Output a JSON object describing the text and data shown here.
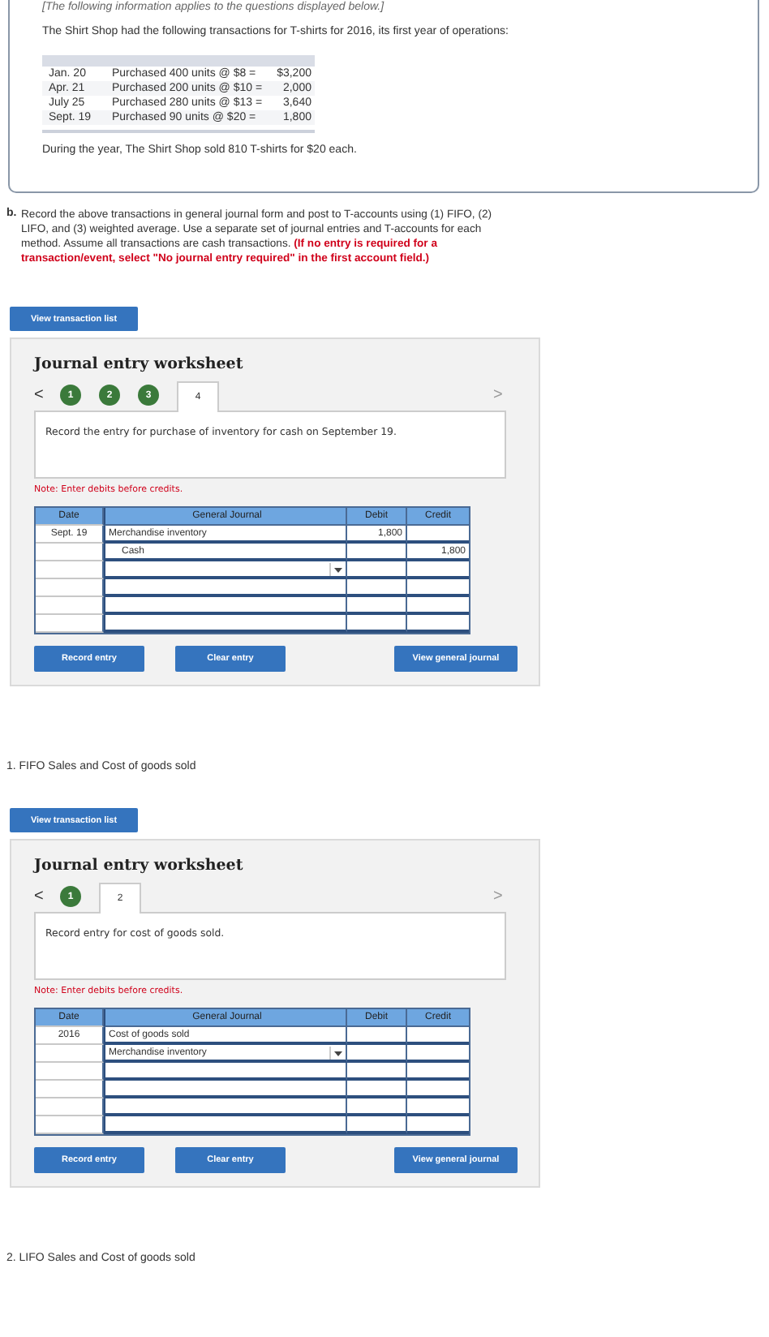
{
  "intro": {
    "header": "[The following information applies to the questions displayed below.]",
    "text": "The Shirt Shop had the following transactions for T-shirts for 2016, its first year of operations:",
    "transactions": [
      {
        "date": "Jan. 20",
        "desc": "Purchased  400 units @ $8 =",
        "amount": "$3,200"
      },
      {
        "date": "Apr. 21",
        "desc": "Purchased 200 units @ $10 =",
        "amount": "2,000"
      },
      {
        "date": "July 25",
        "desc": "Purchased 280 units @ $13 =",
        "amount": "3,640"
      },
      {
        "date": "Sept. 19",
        "desc": "Purchased  90 units @ $20 =",
        "amount": "1,800"
      }
    ],
    "footer": "During the year, The Shirt Shop sold 810 T-shirts for $20 each."
  },
  "question": {
    "label": "b.",
    "text": "Record the above transactions in general journal form and post to T-accounts using (1) FIFO, (2) LIFO, and (3) weighted average. Use a separate set of journal entries and T-accounts for each method. Assume all transactions are cash transactions.",
    "warning": "(If no entry is required for a transaction/event, select \"No journal entry required\" in the first account field.)"
  },
  "sections": [
    {
      "button": "View transaction list",
      "worksheet": {
        "title": "Journal entry worksheet",
        "prev": "<",
        "next": ">",
        "tabs": [
          {
            "label": "1",
            "selected": false
          },
          {
            "label": "2",
            "selected": false
          },
          {
            "label": "3",
            "selected": false
          },
          {
            "label": "4",
            "selected": true
          }
        ],
        "instruction": "Record the entry for purchase of inventory for cash on September 19.",
        "note": "Note: Enter debits before credits.",
        "columns": [
          "Date",
          "General Journal",
          "Debit",
          "Credit"
        ],
        "rows": [
          {
            "date": "Sept. 19",
            "account": "Merchandise inventory",
            "debit": "1,800",
            "indented": false,
            "dropdown": false
          },
          {
            "account": "Cash",
            "credit": "1,800",
            "indented": true,
            "dropdown": false
          },
          {
            "dropdown": true
          },
          {
            "dropdown": false
          },
          {
            "dropdown": false
          },
          {
            "dropdown": false
          }
        ],
        "buttons": [
          "Record entry",
          "Clear entry",
          "View general journal"
        ]
      }
    },
    {
      "heading": "1.  FIFO Sales and Cost of goods sold",
      "button": "View transaction list",
      "worksheet": {
        "title": "Journal entry worksheet",
        "prev": "<",
        "next": ">",
        "tabs": [
          {
            "label": "1",
            "selected": false
          },
          {
            "label": "2",
            "selected": true
          }
        ],
        "instruction": "Record entry for cost of goods sold.",
        "note": "Note: Enter debits before credits.",
        "columns": [
          "Date",
          "General Journal",
          "Debit",
          "Credit"
        ],
        "rows": [
          {
            "date": "2016",
            "account": "Cost of goods sold",
            "indented": false,
            "dropdown": false
          },
          {
            "account": "Merchandise inventory",
            "indented": false,
            "dropdown": true
          },
          {
            "dropdown": false
          },
          {
            "dropdown": false
          },
          {
            "dropdown": false
          },
          {
            "dropdown": false
          }
        ],
        "buttons": [
          "Record entry",
          "Clear entry",
          "View general journal"
        ]
      }
    }
  ],
  "next_heading": "2. LIFO Sales and Cost of goods sold"
}
